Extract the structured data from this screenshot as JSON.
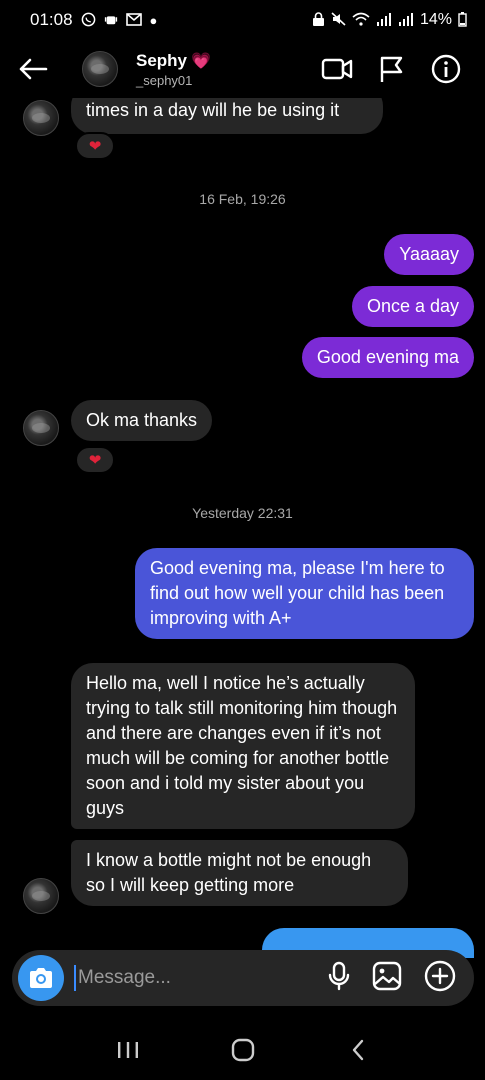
{
  "status": {
    "time": "01:08",
    "battery": "14%"
  },
  "header": {
    "name": "Sephy",
    "handle": "_sephy01"
  },
  "messages": {
    "m0_text": "times in a day will he be using it",
    "ts1": "16 Feb, 19:26",
    "m1_text": "Yaaaay",
    "m2_text": "Once a day",
    "m3_text": "Good evening ma",
    "m4_text": "Ok ma thanks",
    "ts2": "Yesterday 22:31",
    "m5_text": "Good evening ma, please I'm here to find out how well your child has been improving with A+",
    "m6_text": "Hello ma, well I notice he’s actually trying to talk still monitoring him though and there are changes even if it’s not much will be coming for another bottle soon and i told my sister about you guys",
    "m7_text": "I know a bottle might not be enough so I will keep getting more",
    "reaction": "❤"
  },
  "composer": {
    "placeholder": "Message..."
  },
  "colors": {
    "incoming": "#262626",
    "outgoing_purple": "#7c2bd6",
    "outgoing_blue": "#4a55d8",
    "accent": "#3897f0"
  }
}
